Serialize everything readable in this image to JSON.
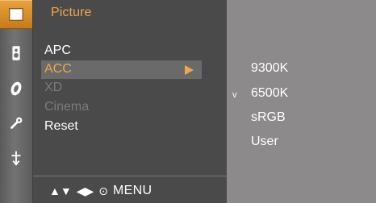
{
  "menu": {
    "title": "Picture",
    "items": [
      {
        "label": "APC",
        "state": "normal"
      },
      {
        "label": "ACC",
        "state": "selected"
      },
      {
        "label": "XD",
        "state": "disabled"
      },
      {
        "label": "Cinema",
        "state": "disabled"
      },
      {
        "label": "Reset",
        "state": "normal"
      }
    ],
    "submenu": [
      {
        "label": "9300K",
        "checked": false
      },
      {
        "label": "6500K",
        "checked": true
      },
      {
        "label": "sRGB",
        "checked": false
      },
      {
        "label": "User",
        "checked": false
      }
    ]
  },
  "bottom_nav": {
    "updown": "▲▼",
    "leftright": "◀▶",
    "ok": "⊙",
    "menu": "MENU"
  },
  "check_mark": "v",
  "sidebar_icons": [
    {
      "name": "picture-icon",
      "active": true
    },
    {
      "name": "audio-icon",
      "active": false
    },
    {
      "name": "time-icon",
      "active": false
    },
    {
      "name": "option-icon",
      "active": false
    },
    {
      "name": "input-icon",
      "active": false
    }
  ],
  "colors": {
    "accent": "#f0a64a",
    "panel": "#4b4a4b",
    "subpanel": "#8c8a8b",
    "selection": "#6a6a6a",
    "disabled_text": "#7b7b7b"
  }
}
